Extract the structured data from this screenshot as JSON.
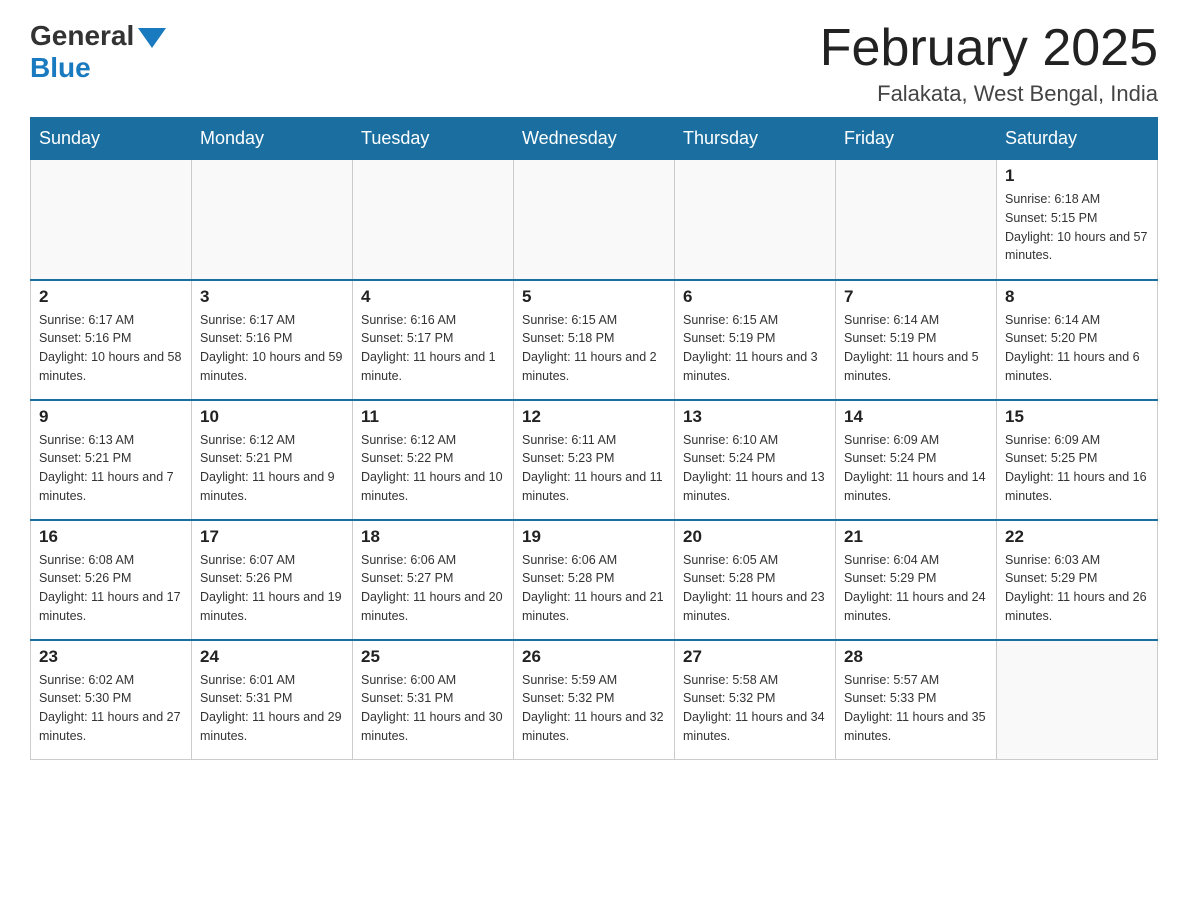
{
  "header": {
    "logo_general": "General",
    "logo_blue": "Blue",
    "month_title": "February 2025",
    "location": "Falakata, West Bengal, India"
  },
  "days_of_week": [
    "Sunday",
    "Monday",
    "Tuesday",
    "Wednesday",
    "Thursday",
    "Friday",
    "Saturday"
  ],
  "weeks": [
    [
      {
        "day": "",
        "info": ""
      },
      {
        "day": "",
        "info": ""
      },
      {
        "day": "",
        "info": ""
      },
      {
        "day": "",
        "info": ""
      },
      {
        "day": "",
        "info": ""
      },
      {
        "day": "",
        "info": ""
      },
      {
        "day": "1",
        "info": "Sunrise: 6:18 AM\nSunset: 5:15 PM\nDaylight: 10 hours and 57 minutes."
      }
    ],
    [
      {
        "day": "2",
        "info": "Sunrise: 6:17 AM\nSunset: 5:16 PM\nDaylight: 10 hours and 58 minutes."
      },
      {
        "day": "3",
        "info": "Sunrise: 6:17 AM\nSunset: 5:16 PM\nDaylight: 10 hours and 59 minutes."
      },
      {
        "day": "4",
        "info": "Sunrise: 6:16 AM\nSunset: 5:17 PM\nDaylight: 11 hours and 1 minute."
      },
      {
        "day": "5",
        "info": "Sunrise: 6:15 AM\nSunset: 5:18 PM\nDaylight: 11 hours and 2 minutes."
      },
      {
        "day": "6",
        "info": "Sunrise: 6:15 AM\nSunset: 5:19 PM\nDaylight: 11 hours and 3 minutes."
      },
      {
        "day": "7",
        "info": "Sunrise: 6:14 AM\nSunset: 5:19 PM\nDaylight: 11 hours and 5 minutes."
      },
      {
        "day": "8",
        "info": "Sunrise: 6:14 AM\nSunset: 5:20 PM\nDaylight: 11 hours and 6 minutes."
      }
    ],
    [
      {
        "day": "9",
        "info": "Sunrise: 6:13 AM\nSunset: 5:21 PM\nDaylight: 11 hours and 7 minutes."
      },
      {
        "day": "10",
        "info": "Sunrise: 6:12 AM\nSunset: 5:21 PM\nDaylight: 11 hours and 9 minutes."
      },
      {
        "day": "11",
        "info": "Sunrise: 6:12 AM\nSunset: 5:22 PM\nDaylight: 11 hours and 10 minutes."
      },
      {
        "day": "12",
        "info": "Sunrise: 6:11 AM\nSunset: 5:23 PM\nDaylight: 11 hours and 11 minutes."
      },
      {
        "day": "13",
        "info": "Sunrise: 6:10 AM\nSunset: 5:24 PM\nDaylight: 11 hours and 13 minutes."
      },
      {
        "day": "14",
        "info": "Sunrise: 6:09 AM\nSunset: 5:24 PM\nDaylight: 11 hours and 14 minutes."
      },
      {
        "day": "15",
        "info": "Sunrise: 6:09 AM\nSunset: 5:25 PM\nDaylight: 11 hours and 16 minutes."
      }
    ],
    [
      {
        "day": "16",
        "info": "Sunrise: 6:08 AM\nSunset: 5:26 PM\nDaylight: 11 hours and 17 minutes."
      },
      {
        "day": "17",
        "info": "Sunrise: 6:07 AM\nSunset: 5:26 PM\nDaylight: 11 hours and 19 minutes."
      },
      {
        "day": "18",
        "info": "Sunrise: 6:06 AM\nSunset: 5:27 PM\nDaylight: 11 hours and 20 minutes."
      },
      {
        "day": "19",
        "info": "Sunrise: 6:06 AM\nSunset: 5:28 PM\nDaylight: 11 hours and 21 minutes."
      },
      {
        "day": "20",
        "info": "Sunrise: 6:05 AM\nSunset: 5:28 PM\nDaylight: 11 hours and 23 minutes."
      },
      {
        "day": "21",
        "info": "Sunrise: 6:04 AM\nSunset: 5:29 PM\nDaylight: 11 hours and 24 minutes."
      },
      {
        "day": "22",
        "info": "Sunrise: 6:03 AM\nSunset: 5:29 PM\nDaylight: 11 hours and 26 minutes."
      }
    ],
    [
      {
        "day": "23",
        "info": "Sunrise: 6:02 AM\nSunset: 5:30 PM\nDaylight: 11 hours and 27 minutes."
      },
      {
        "day": "24",
        "info": "Sunrise: 6:01 AM\nSunset: 5:31 PM\nDaylight: 11 hours and 29 minutes."
      },
      {
        "day": "25",
        "info": "Sunrise: 6:00 AM\nSunset: 5:31 PM\nDaylight: 11 hours and 30 minutes."
      },
      {
        "day": "26",
        "info": "Sunrise: 5:59 AM\nSunset: 5:32 PM\nDaylight: 11 hours and 32 minutes."
      },
      {
        "day": "27",
        "info": "Sunrise: 5:58 AM\nSunset: 5:32 PM\nDaylight: 11 hours and 34 minutes."
      },
      {
        "day": "28",
        "info": "Sunrise: 5:57 AM\nSunset: 5:33 PM\nDaylight: 11 hours and 35 minutes."
      },
      {
        "day": "",
        "info": ""
      }
    ]
  ]
}
